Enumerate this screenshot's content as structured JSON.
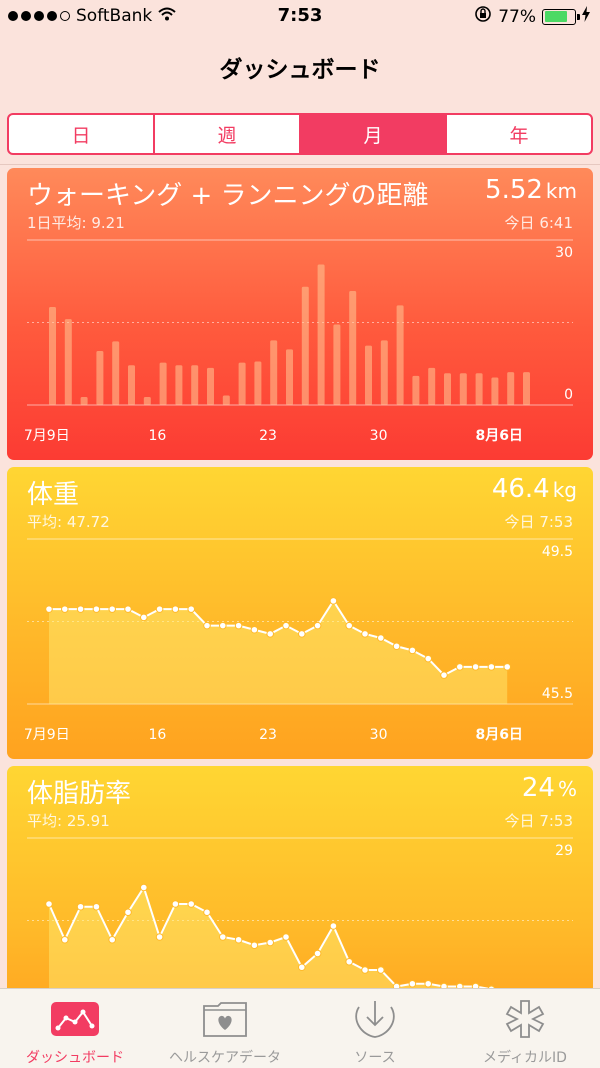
{
  "status_bar": {
    "carrier": "SoftBank",
    "time": "7:53",
    "battery": "77%",
    "battery_level": 0.77
  },
  "nav": {
    "title": "ダッシュボード"
  },
  "segments": [
    {
      "label": "日",
      "active": false
    },
    {
      "label": "週",
      "active": false
    },
    {
      "label": "月",
      "active": true
    },
    {
      "label": "年",
      "active": false
    }
  ],
  "cards": {
    "walk": {
      "title": "ウォーキング + ランニングの距離",
      "value": "5.52",
      "unit": "km",
      "average": "1日平均: 9.21",
      "time": "今日 6:41",
      "accent": "#ff5a3d"
    },
    "weight": {
      "title": "体重",
      "value": "46.4",
      "unit": "kg",
      "average": "平均: 47.72",
      "time": "今日 7:53",
      "accent": "#ffb92a"
    },
    "fat": {
      "title": "体脂肪率",
      "value": "24",
      "unit": "%",
      "average": "平均: 25.91",
      "time": "今日 7:53",
      "accent": "#ffb92a"
    }
  },
  "x_tick_labels": [
    "7月9日",
    "16",
    "23",
    "30",
    "8月6日"
  ],
  "chart_data": [
    {
      "type": "bar",
      "title": "ウォーキング + ランニングの距離",
      "x": [
        "7/8",
        "7/9",
        "7/10",
        "7/11",
        "7/12",
        "7/13",
        "7/14",
        "7/15",
        "7/16",
        "7/17",
        "7/18",
        "7/19",
        "7/20",
        "7/21",
        "7/22",
        "7/23",
        "7/24",
        "7/25",
        "7/26",
        "7/27",
        "7/28",
        "7/29",
        "7/30",
        "7/31",
        "8/1",
        "8/2",
        "8/3",
        "8/4",
        "8/5",
        "8/6"
      ],
      "values": [
        18.5,
        16.2,
        1.5,
        10.2,
        12.0,
        7.5,
        1.5,
        8.0,
        7.5,
        7.5,
        7.0,
        1.8,
        8.0,
        8.2,
        12.2,
        10.5,
        22.3,
        26.5,
        15.2,
        21.5,
        11.2,
        12.2,
        18.8,
        5.5,
        7.0,
        6.0,
        6.0,
        6.0,
        5.2,
        6.2,
        6.2
      ],
      "ylim": [
        0,
        30
      ],
      "y_tick_labels": [
        "30",
        "0"
      ]
    },
    {
      "type": "line",
      "title": "体重",
      "values": [
        47.8,
        47.8,
        47.8,
        47.8,
        47.8,
        47.8,
        47.6,
        47.8,
        47.8,
        47.8,
        47.4,
        47.4,
        47.4,
        47.3,
        47.2,
        47.4,
        47.2,
        47.4,
        48.0,
        47.4,
        47.2,
        47.1,
        46.9,
        46.8,
        46.6,
        46.2,
        46.4,
        46.4,
        46.4,
        46.4
      ],
      "ylim": [
        45.5,
        49.5
      ],
      "y_tick_labels": [
        "49.5",
        "45.5"
      ]
    },
    {
      "type": "line",
      "title": "体脂肪率",
      "values": [
        26.6,
        25.3,
        26.5,
        26.5,
        25.3,
        26.3,
        27.2,
        25.4,
        26.6,
        26.6,
        26.3,
        25.4,
        25.3,
        25.1,
        25.2,
        25.4,
        24.3,
        24.8,
        25.8,
        24.5,
        24.2,
        24.2,
        23.6,
        23.7,
        23.7,
        23.6,
        23.6,
        23.6,
        23.5,
        23.2
      ],
      "ylim": [
        23.0,
        29.0
      ],
      "y_tick_labels": [
        "29"
      ]
    }
  ],
  "tabbar": [
    {
      "label": "ダッシュボード",
      "icon": "dashboard-chart-icon",
      "active": true
    },
    {
      "label": "ヘルスケアデータ",
      "icon": "health-data-folder-icon",
      "active": false
    },
    {
      "label": "ソース",
      "icon": "sources-download-icon",
      "active": false
    },
    {
      "label": "メディカルID",
      "icon": "medical-id-star-icon",
      "active": false
    }
  ]
}
